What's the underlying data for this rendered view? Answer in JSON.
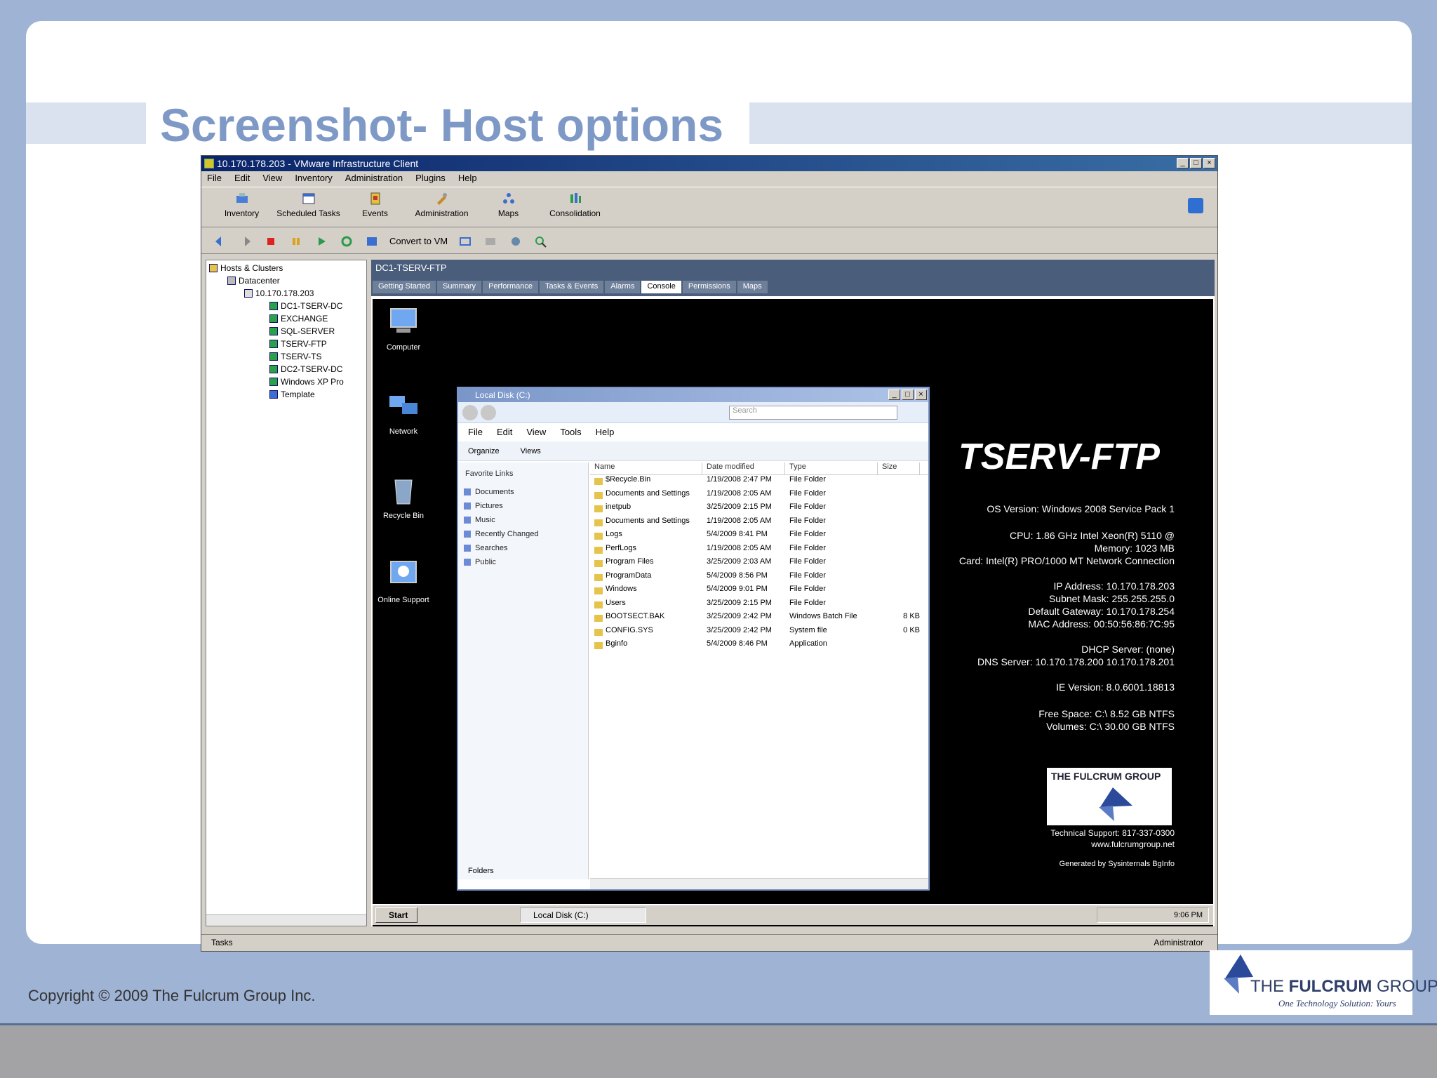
{
  "slide": {
    "title": "Screenshot- Host options",
    "copyright": "Copyright © 2009 The Fulcrum Group Inc.",
    "logo_brand_prefix": "THE ",
    "logo_brand_bold": "FULCRUM",
    "logo_brand_suffix": " GROUP",
    "logo_tagline": "One Technology Solution: Yours"
  },
  "window": {
    "title": "10.170.178.203 - VMware Infrastructure Client",
    "menu": [
      "File",
      "Edit",
      "View",
      "Inventory",
      "Administration",
      "Plugins",
      "Help"
    ],
    "toolbar": [
      "Inventory",
      "Scheduled Tasks",
      "Events",
      "Administration",
      "Maps",
      "Consolidation"
    ],
    "toolbar2_label": "Convert to VM"
  },
  "tree": {
    "items": [
      "Hosts & Clusters",
      "Datacenter",
      "10.170.178.203",
      "DC1-TSERV-DC",
      "EXCHANGE",
      "SQL-SERVER",
      "TSERV-FTP",
      "TSERV-TS",
      "DC2-TSERV-DC",
      "Windows XP Pro",
      "Template"
    ]
  },
  "pane": {
    "title": "DC1-TSERV-FTP",
    "tabs": [
      "Getting Started",
      "Summary",
      "Performance",
      "Tasks & Events",
      "Alarms",
      "Console",
      "Permissions",
      "Maps"
    ],
    "active_tab": "Console"
  },
  "console": {
    "desktop_icons": [
      "Computer",
      "Network",
      "Recycle Bin",
      "Online Support"
    ],
    "server_name": "TSERV-FTP",
    "info": [
      "OS Version: Windows 2008 Service Pack 1",
      "CPU: 1.86 GHz Intel Xeon(R)   5110 @",
      "Memory: 1023 MB",
      "Card: Intel(R) PRO/1000 MT Network Connection",
      "IP Address: 10.170.178.203",
      "Subnet Mask: 255.255.255.0",
      "Default Gateway: 10.170.178.254",
      "MAC Address: 00:50:56:86:7C:95",
      "DHCP Server: (none)",
      "DNS Server: 10.170.178.200 10.170.178.201",
      "IE Version: 8.0.6001.18813",
      "Free Space: C:\\ 8.52 GB NTFS",
      "Volumes: C:\\ 30.00 GB NTFS"
    ],
    "logo_label": "THE FULCRUM GROUP",
    "support_line": "Technical Support: 817-337-0300",
    "url_line": "www.fulcrumgroup.net",
    "credit_line": "Generated by Sysinternals BgInfo"
  },
  "explorer": {
    "title": "Local Disk (C:)",
    "search_placeholder": "Search",
    "menu": [
      "File",
      "Edit",
      "View",
      "Tools",
      "Help"
    ],
    "cmd": [
      "Organize",
      "Views"
    ],
    "favorites_header": "Favorite Links",
    "favorites": [
      "Documents",
      "Pictures",
      "Music",
      "Recently Changed",
      "Searches",
      "Public"
    ],
    "folders_label": "Folders",
    "columns": [
      "Name",
      "Date modified",
      "Type",
      "Size"
    ],
    "rows": [
      {
        "name": "$Recycle.Bin",
        "date": "1/19/2008 2:47 PM",
        "type": "File Folder",
        "size": ""
      },
      {
        "name": "Documents and Settings",
        "date": "1/19/2008 2:05 AM",
        "type": "File Folder",
        "size": ""
      },
      {
        "name": "inetpub",
        "date": "3/25/2009 2:15 PM",
        "type": "File Folder",
        "size": ""
      },
      {
        "name": "Documents and Settings",
        "date": "1/19/2008 2:05 AM",
        "type": "File Folder",
        "size": ""
      },
      {
        "name": "Logs",
        "date": "5/4/2009 8:41 PM",
        "type": "File Folder",
        "size": ""
      },
      {
        "name": "PerfLogs",
        "date": "1/19/2008 2:05 AM",
        "type": "File Folder",
        "size": ""
      },
      {
        "name": "Program Files",
        "date": "3/25/2009 2:03 AM",
        "type": "File Folder",
        "size": ""
      },
      {
        "name": "ProgramData",
        "date": "5/4/2009 8:56 PM",
        "type": "File Folder",
        "size": ""
      },
      {
        "name": "Windows",
        "date": "5/4/2009 9:01 PM",
        "type": "File Folder",
        "size": ""
      },
      {
        "name": "Users",
        "date": "3/25/2009 2:15 PM",
        "type": "File Folder",
        "size": ""
      },
      {
        "name": "BOOTSECT.BAK",
        "date": "3/25/2009 2:42 PM",
        "type": "Windows Batch File",
        "size": "8 KB"
      },
      {
        "name": "CONFIG.SYS",
        "date": "3/25/2009 2:42 PM",
        "type": "System file",
        "size": "0 KB"
      },
      {
        "name": "Bginfo",
        "date": "5/4/2009 8:46 PM",
        "type": "Application",
        "size": ""
      }
    ]
  },
  "taskbar": {
    "start": "Start",
    "task": "Local Disk (C:)",
    "clock": "9:06 PM"
  },
  "status": {
    "left": "Tasks",
    "right": "Administrator"
  }
}
